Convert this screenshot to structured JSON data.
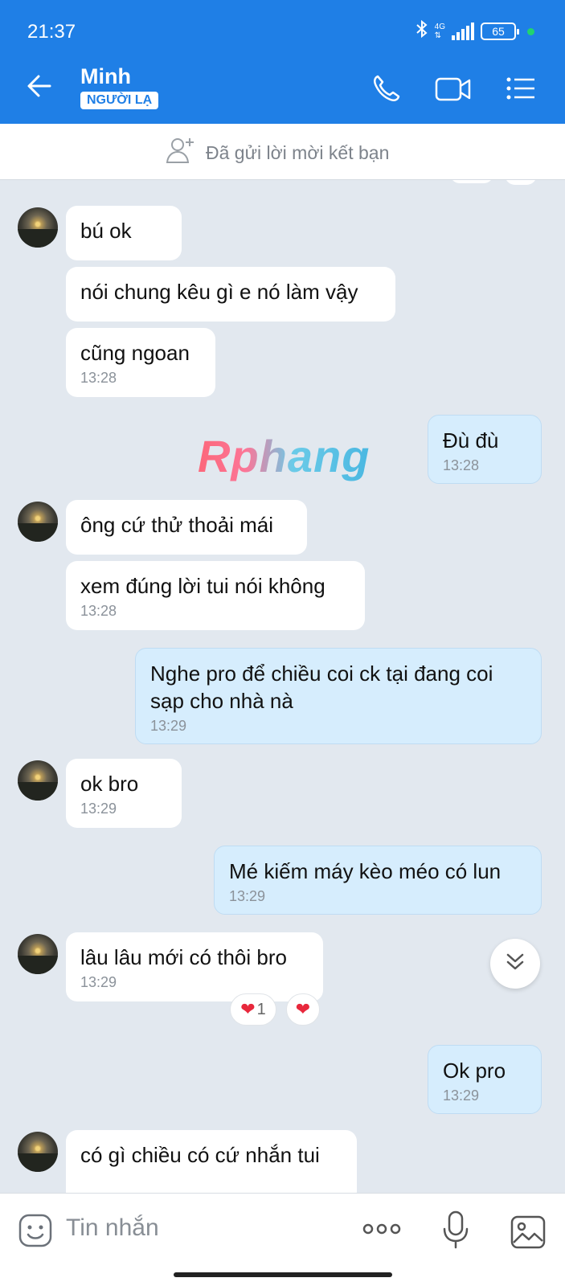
{
  "status_bar": {
    "time": "21:37",
    "network": "4G",
    "battery": "65",
    "bluetooth_icon": "bluetooth-icon"
  },
  "header": {
    "contact_name": "Minh",
    "badge": "NGƯỜI LẠ",
    "accent_color": "#1f7fe6"
  },
  "friend_request_banner": {
    "text": "Đã gửi lời mời kết bạn"
  },
  "messages": [
    {
      "side": "them",
      "text": "bú ok"
    },
    {
      "side": "them",
      "text": "nói chung kêu gì e nó làm vậy"
    },
    {
      "side": "them",
      "text": "cũng ngoan",
      "time": "13:28"
    },
    {
      "side": "me",
      "text": "Đù đù",
      "time": "13:28"
    },
    {
      "side": "them",
      "text": "ông cứ thử thoải mái"
    },
    {
      "side": "them",
      "text": "xem đúng lời tui nói không",
      "time": "13:28"
    },
    {
      "side": "me",
      "text": "Nghe pro để chiều coi ck tại đang coi sạp cho nhà nà",
      "time": "13:29"
    },
    {
      "side": "them",
      "text": "ok bro",
      "time": "13:29"
    },
    {
      "side": "me",
      "text": "Mé kiếm máy kèo méo có lun",
      "time": "13:29"
    },
    {
      "side": "them",
      "text": "lâu lâu mới có thôi bro",
      "time": "13:29",
      "reaction_count": "1"
    },
    {
      "side": "me",
      "text": "Ok pro",
      "time": "13:29"
    },
    {
      "side": "them",
      "text": "có gì chiều có cứ nhắn tui"
    }
  ],
  "watermark": "Rphang",
  "input": {
    "placeholder": "Tin nhắn"
  }
}
